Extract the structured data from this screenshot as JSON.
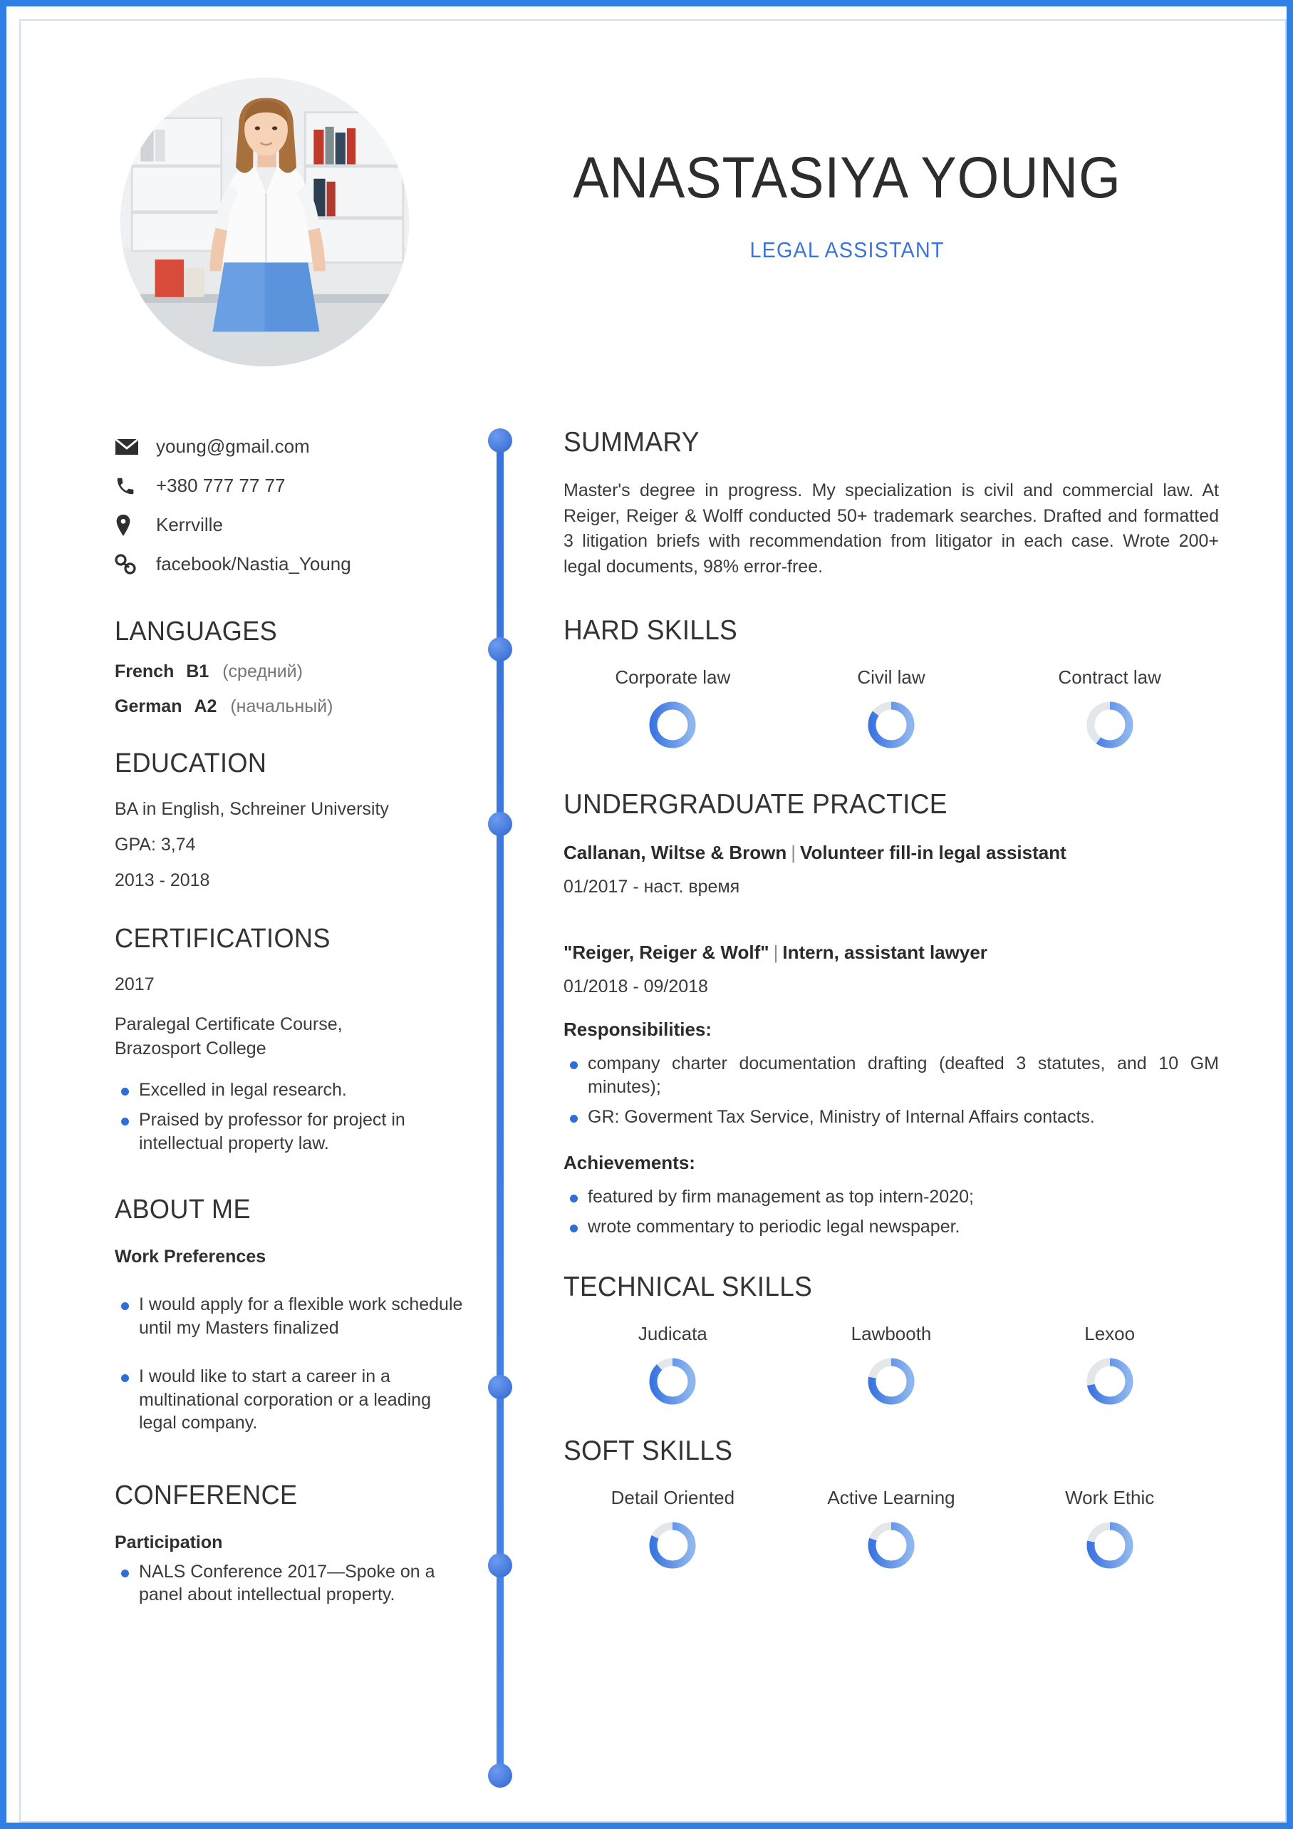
{
  "theme": {
    "frame_color": "#2f7fe4",
    "accent_blue": "#3d74d8",
    "bullet_blue": "#2f6ed4",
    "text_dark": "#2d2d2d",
    "text_body": "#3b3b3b",
    "muted": "#767676",
    "track_gray": "#e4e7ea"
  },
  "header": {
    "full_name": "ANASTASIYA YOUNG",
    "job_title": "LEGAL ASSISTANT",
    "photo_alt": "profile-photo"
  },
  "contact": {
    "items": [
      {
        "icon": "envelope-icon",
        "value": "young@gmail.com"
      },
      {
        "icon": "phone-icon",
        "value": "+380 777 77 77"
      },
      {
        "icon": "location-pin-icon",
        "value": "Kerrville"
      },
      {
        "icon": "link-icon",
        "value": "facebook/Nastia_Young"
      }
    ]
  },
  "languages": {
    "heading": "LANGUAGES",
    "items": [
      {
        "name": "French",
        "code": "B1",
        "level": "(средний)"
      },
      {
        "name": "German",
        "code": "A2",
        "level": "(начальный)"
      }
    ]
  },
  "education": {
    "heading": "EDUCATION",
    "degree": "BA in English, Schreiner University",
    "gpa": "GPA: 3,74",
    "years": "2013 - 2018"
  },
  "certifications": {
    "heading": "CERTIFICATIONS",
    "year": "2017",
    "course_line1": "Paralegal Certificate Course,",
    "course_line2": "Brazosport College",
    "bullets": [
      "Excelled in legal research.",
      "Praised by professor for project in intellectual property law."
    ]
  },
  "about_me": {
    "heading": "ABOUT ME",
    "subheading": "Work Preferences",
    "bullets": [
      "I would apply for a flexible work schedule until my Masters finalized",
      "I would like to start a career in a multinational corporation or a leading legal company."
    ]
  },
  "conference": {
    "heading": "CONFERENCE",
    "subheading": "Participation",
    "bullets": [
      "NALS Conference 2017—Spoke on a panel about intellectual property."
    ]
  },
  "summary": {
    "heading": "SUMMARY",
    "text": "Master's degree in progress. My specialization is civil and commercial law. At Reiger, Reiger & Wolff conducted 50+ trademark searches. Drafted and formatted 3 litigation briefs with recommendation from litigator in each case. Wrote 200+ legal documents, 98% error-free."
  },
  "hard_skills": {
    "heading": "HARD SKILLS"
  },
  "practice": {
    "heading": "UNDERGRADUATE PRACTICE",
    "jobs": [
      {
        "company": "Callanan, Wiltse & Brown",
        "role": "Volunteer fill-in legal assistant",
        "dates": "01/2017 - наст. время"
      },
      {
        "company": "\"Reiger, Reiger & Wolf\"",
        "role": "Intern, assistant lawyer",
        "dates": "01/2018 - 09/2018",
        "responsibilities_label": "Responsibilities:",
        "responsibilities": [
          "company charter documentation drafting (deafted 3 statutes, and 10 GM minutes);",
          "GR: Goverment Tax Service, Ministry of Internal Affairs contacts."
        ],
        "achievements_label": "Achievements:",
        "achievements": [
          "featured by firm management as top intern-2020;",
          "wrote commentary to periodic legal newspaper."
        ]
      }
    ]
  },
  "technical_skills": {
    "heading": "TECHNICAL SKILLS"
  },
  "soft_skills": {
    "heading": "SOFT SKILLS"
  },
  "chart_data": [
    {
      "type": "pie",
      "title": "HARD SKILLS",
      "categories": [
        "Corporate law",
        "Civil law",
        "Contract law"
      ],
      "values": [
        100,
        85,
        60
      ],
      "ylim": [
        0,
        100
      ],
      "legend": "none"
    },
    {
      "type": "pie",
      "title": "TECHNICAL SKILLS",
      "categories": [
        "Judicata",
        "Lawbooth",
        "Lexoo"
      ],
      "values": [
        88,
        78,
        72
      ],
      "ylim": [
        0,
        100
      ],
      "legend": "none"
    },
    {
      "type": "pie",
      "title": "SOFT SKILLS",
      "categories": [
        "Detail Oriented",
        "Active Learning",
        "Work Ethic"
      ],
      "values": [
        82,
        80,
        78
      ],
      "ylim": [
        0,
        100
      ],
      "legend": "none"
    }
  ]
}
